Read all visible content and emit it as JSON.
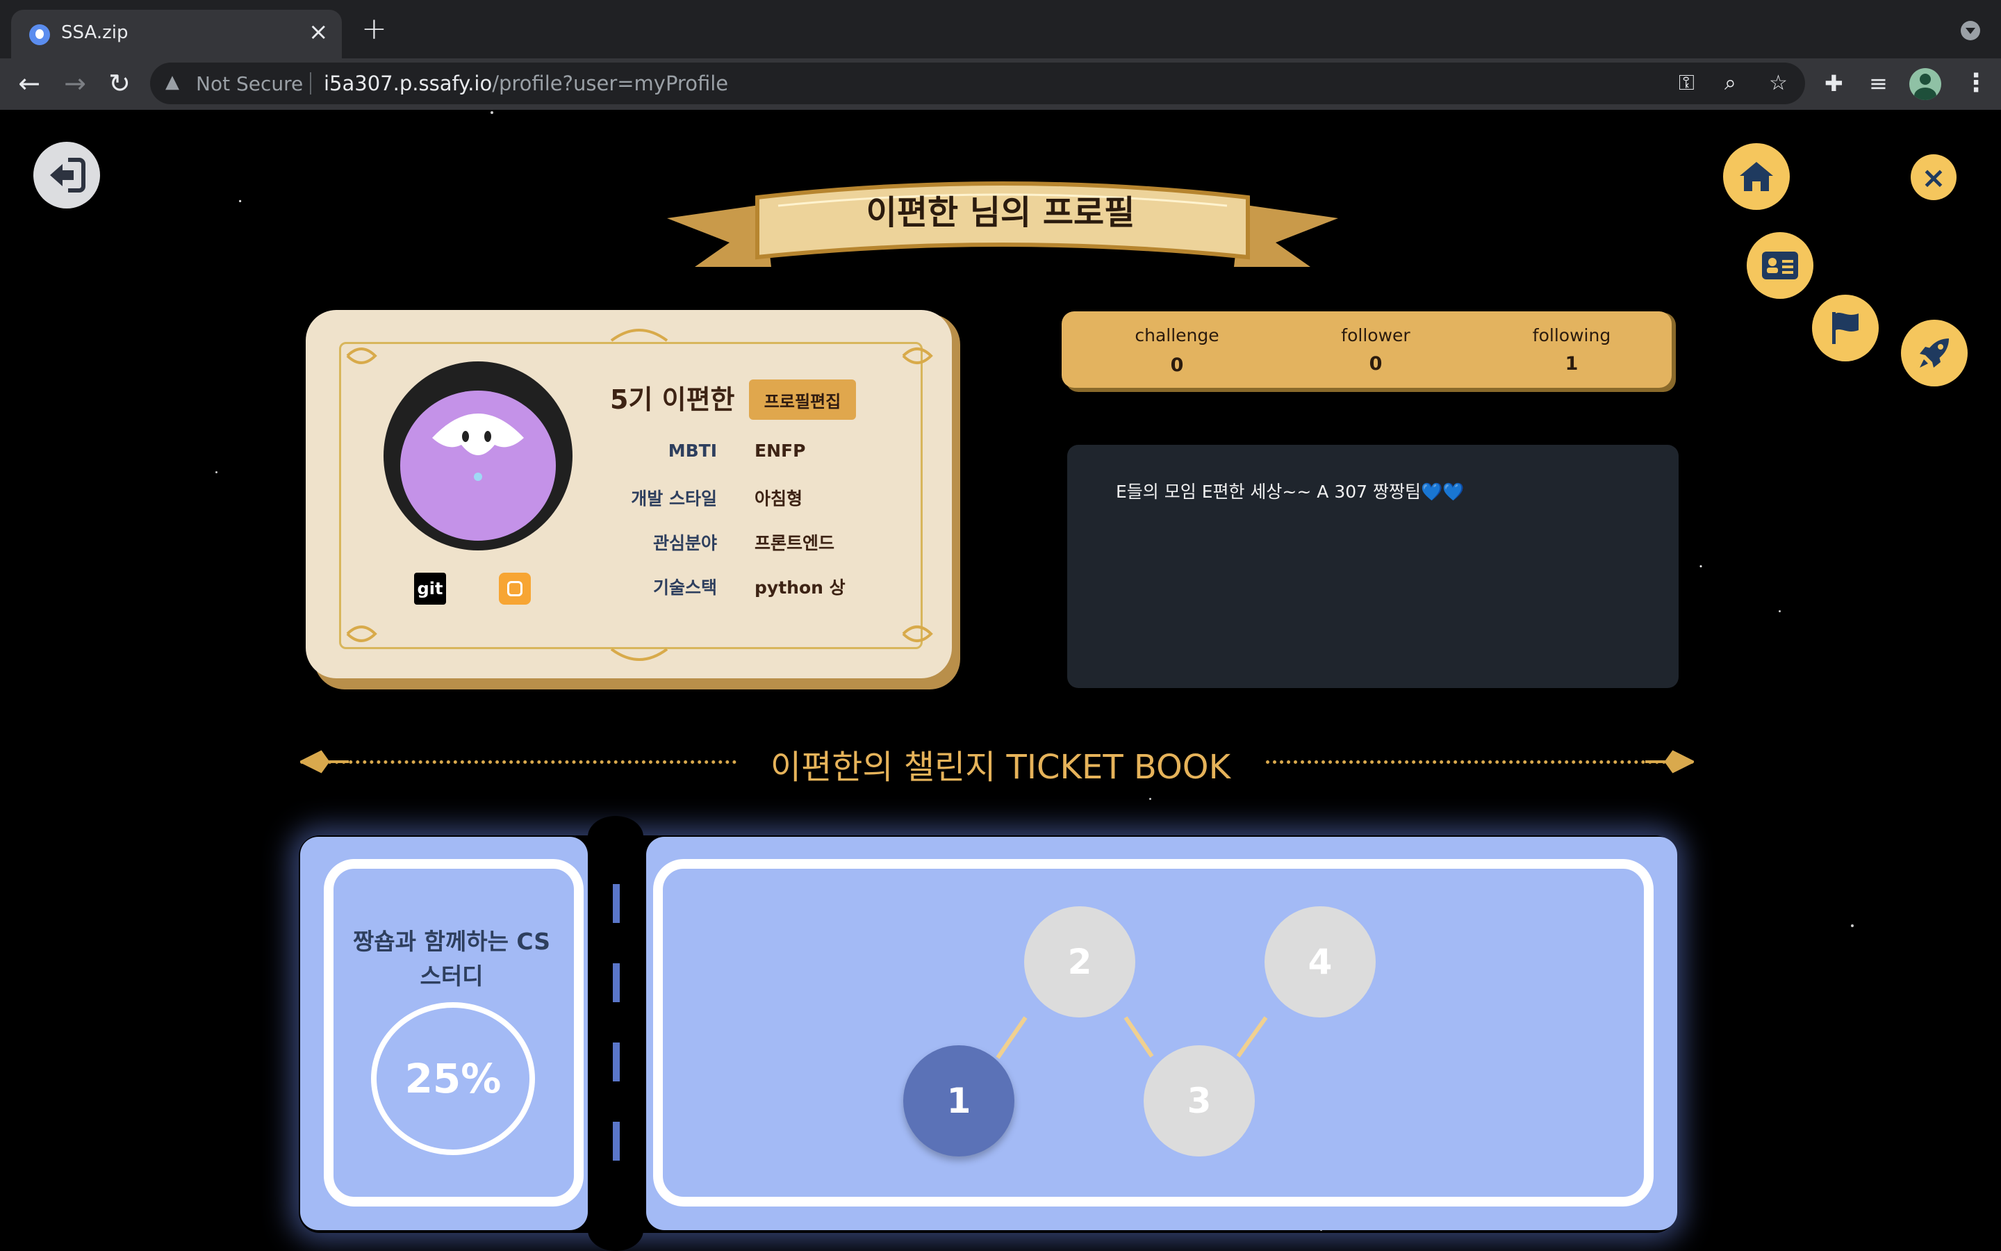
{
  "browser": {
    "tab_title": "SSA.zip",
    "tab_close": "×",
    "new_tab": "+",
    "security_label": "Not Secure",
    "url_host": "i5a307.p.ssafy.io",
    "url_path": "/profile?user=myProfile"
  },
  "page": {
    "banner_title": "이편한 님의 프로필",
    "close_symbol": "×"
  },
  "profile": {
    "name": "5기 이편한",
    "edit_button": "프로필편집",
    "git_label": "git",
    "fields": [
      {
        "label": "MBTI",
        "value": "ENFP"
      },
      {
        "label": "개발 스타일",
        "value": "아침형"
      },
      {
        "label": "관심분야",
        "value": "프론트엔드"
      },
      {
        "label": "기술스택",
        "value": "python 상"
      }
    ]
  },
  "stats": [
    {
      "label": "challenge",
      "value": "0"
    },
    {
      "label": "follower",
      "value": "0"
    },
    {
      "label": "following",
      "value": "1"
    }
  ],
  "intro": {
    "text": "E들의 모임 E편한 세상~~ A 307 짱짱팀",
    "hearts": "💙💙"
  },
  "ticket_book": {
    "title": "이편한의 챌린지 TICKET BOOK",
    "challenge_title": "짱숍과 함께하는 CS 스터디",
    "progress_label": "25%",
    "progress": 0.25,
    "steps": [
      {
        "label": "1",
        "status": "done"
      },
      {
        "label": "2",
        "status": "pending"
      },
      {
        "label": "3",
        "status": "pending"
      },
      {
        "label": "4",
        "status": "pending"
      }
    ]
  },
  "colors": {
    "accent_gold": "#e3b35f",
    "button_yellow": "#f5c65d",
    "ticket_blue": "#a3baf5",
    "step_done": "#5b72b7",
    "step_pending": "#dcdcdc"
  },
  "icons": [
    "back-exit-icon",
    "home-icon",
    "id-card-icon",
    "flag-icon",
    "rocket-icon",
    "close-icon",
    "key-icon",
    "zoom-icon",
    "star-icon",
    "puzzle-icon",
    "media-icon"
  ]
}
